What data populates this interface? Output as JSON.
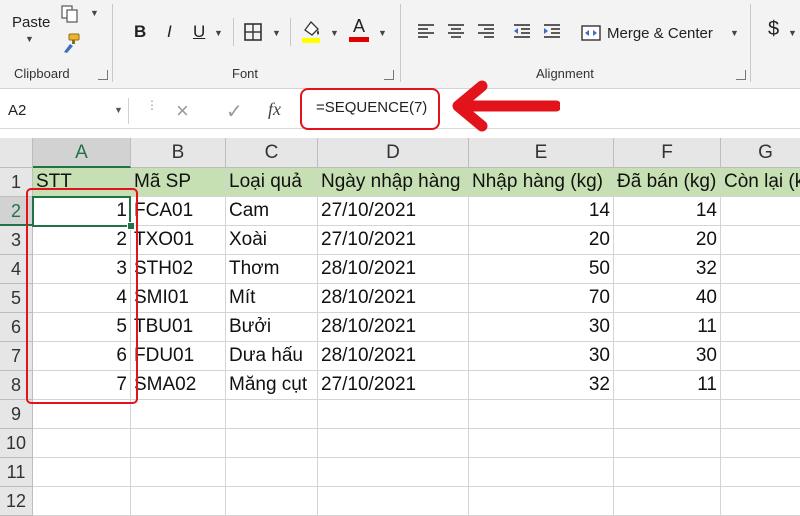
{
  "ribbon": {
    "clipboard": {
      "paste_label": "Paste",
      "group_label": "Clipboard"
    },
    "font": {
      "group_label": "Font",
      "bold": "B",
      "italic": "I",
      "underline": "U",
      "font_color_letter": "A"
    },
    "alignment": {
      "group_label": "Alignment",
      "merge_label": "Merge & Center"
    },
    "number": {
      "currency_symbol": "$"
    },
    "colors": {
      "fill_color": "#ffff00",
      "font_color": "#e00000",
      "accent": "#217346"
    }
  },
  "formula_bar": {
    "name_box": "A2",
    "cancel_icon": "×",
    "enter_icon": "✓",
    "fx_label": "fx",
    "formula": "=SEQUENCE(7)"
  },
  "sheet": {
    "columns": [
      "A",
      "B",
      "C",
      "D",
      "E",
      "F",
      "G"
    ],
    "rows": [
      "1",
      "2",
      "3",
      "4",
      "5",
      "6",
      "7",
      "8",
      "9",
      "10",
      "11",
      "12"
    ],
    "header_row": [
      "STT",
      "Mã SP",
      "Loại quả",
      "Ngày nhập hàng",
      "Nhập hàng (kg)",
      "Đã bán (kg)",
      "Còn lại (k"
    ],
    "data_rows": [
      [
        "1",
        "FCA01",
        "Cam",
        "27/10/2021",
        "14",
        "14",
        ""
      ],
      [
        "2",
        "TXO01",
        "Xoài",
        "27/10/2021",
        "20",
        "20",
        ""
      ],
      [
        "3",
        "STH02",
        "Thơm",
        "28/10/2021",
        "50",
        "32",
        ""
      ],
      [
        "4",
        "SMI01",
        "Mít",
        "28/10/2021",
        "70",
        "40",
        ""
      ],
      [
        "5",
        "TBU01",
        "Bưởi",
        "28/10/2021",
        "30",
        "11",
        ""
      ],
      [
        "6",
        "FDU01",
        "Dưa hấu",
        "28/10/2021",
        "30",
        "30",
        ""
      ],
      [
        "7",
        "SMA02",
        "Măng cụt",
        "27/10/2021",
        "32",
        "11",
        ""
      ]
    ],
    "header_fill": "#c6e0b4",
    "annotation_color": "#e3131b"
  }
}
